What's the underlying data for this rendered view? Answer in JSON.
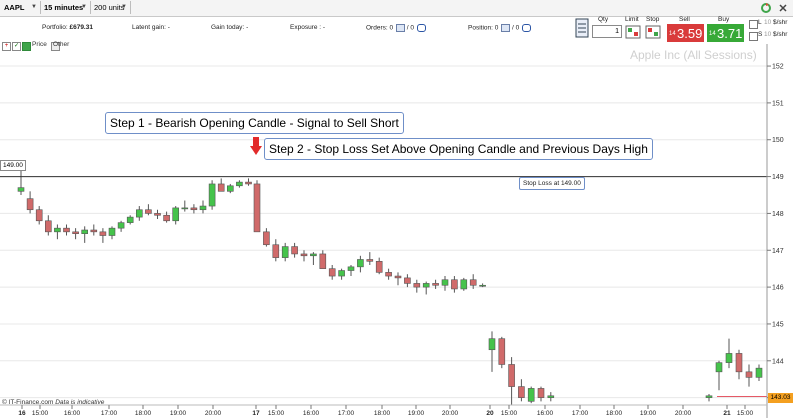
{
  "toolbar": {
    "symbol": "AAPL",
    "interval": "15 minutes",
    "units": "200 units"
  },
  "account": {
    "portfolio_label": "Portfolio:",
    "portfolio_value": "£679.31",
    "latent_gain_label": "Latent gain:",
    "latent_gain_value": "-",
    "gain_today_label": "Gain today:",
    "gain_today_value": "-",
    "exposure_label": "Exposure :",
    "exposure_value": "-",
    "orders_label": "Orders:",
    "orders_value": "0",
    "orders_value2": "0",
    "position_label": "Position:",
    "position_value": "0",
    "position_value2": "0"
  },
  "legend": {
    "price_label": "Price",
    "other_label": "Other"
  },
  "trade_panel": {
    "qty_label": "Qty",
    "qty_value": "1",
    "limit_label": "Limit",
    "stop_label": "Stop",
    "sell_label": "Sell",
    "sell_prefix": "14",
    "sell_price": "3.59",
    "buy_label": "Buy",
    "buy_prefix": "14",
    "buy_price": "3.71",
    "l_label": "L",
    "s_label": "S",
    "l_value": "10",
    "s_value": "10",
    "unit_label_1": "$/shr",
    "unit_label_2": "$/shr"
  },
  "watermark": "Apple Inc (All Sessions)",
  "annotations": {
    "step1": "Step 1 - Bearish Opening Candle - Signal to Sell Short",
    "step2": "Step 2 - Stop Loss Set Above Opening Candle and Previous Days High",
    "stop_loss": "Stop Loss at 149.00",
    "price_149_label": "149.00",
    "price_last_label": "143.03"
  },
  "footer": {
    "brand": "© IT-Finance.com",
    "note": "Data is indicative"
  },
  "colors": {
    "bull": "#45c34b",
    "bear": "#d06a6a",
    "stop_line": "#333333",
    "arrow": "#e22b2b",
    "last_price_bg": "#f4a020",
    "grid": "#e8e8e8"
  },
  "chart_data": {
    "type": "candlestick",
    "ylim": [
      142.8,
      152.3
    ],
    "y_ticks": [
      143,
      144,
      145,
      146,
      147,
      148,
      149,
      150,
      151,
      152
    ],
    "x_ticks": [
      "16",
      "15:00",
      "16:00",
      "17:00",
      "18:00",
      "19:00",
      "20:00",
      "17",
      "15:00",
      "16:00",
      "17:00",
      "18:00",
      "19:00",
      "20:00",
      "20",
      "15:00",
      "16:00",
      "17:00",
      "18:00",
      "19:00",
      "20:00",
      "21",
      "15:00"
    ],
    "bold_x_ticks": [
      "16",
      "17",
      "20",
      "21"
    ],
    "stop_loss_level": 149.0,
    "last_price": 143.03,
    "candles": [
      {
        "o": 148.6,
        "h": 149.3,
        "l": 148.5,
        "c": 148.7
      },
      {
        "o": 148.4,
        "h": 148.6,
        "l": 148.0,
        "c": 148.1
      },
      {
        "o": 148.1,
        "h": 148.2,
        "l": 147.7,
        "c": 147.8
      },
      {
        "o": 147.8,
        "h": 147.95,
        "l": 147.4,
        "c": 147.5
      },
      {
        "o": 147.5,
        "h": 147.7,
        "l": 147.3,
        "c": 147.6
      },
      {
        "o": 147.6,
        "h": 147.7,
        "l": 147.4,
        "c": 147.5
      },
      {
        "o": 147.5,
        "h": 147.6,
        "l": 147.3,
        "c": 147.45
      },
      {
        "o": 147.45,
        "h": 147.65,
        "l": 147.2,
        "c": 147.55
      },
      {
        "o": 147.55,
        "h": 147.7,
        "l": 147.4,
        "c": 147.5
      },
      {
        "o": 147.5,
        "h": 147.6,
        "l": 147.2,
        "c": 147.4
      },
      {
        "o": 147.4,
        "h": 147.65,
        "l": 147.3,
        "c": 147.6
      },
      {
        "o": 147.6,
        "h": 147.8,
        "l": 147.5,
        "c": 147.75
      },
      {
        "o": 147.75,
        "h": 147.95,
        "l": 147.7,
        "c": 147.9
      },
      {
        "o": 147.9,
        "h": 148.2,
        "l": 147.8,
        "c": 148.1
      },
      {
        "o": 148.1,
        "h": 148.25,
        "l": 147.95,
        "c": 148.0
      },
      {
        "o": 148.0,
        "h": 148.1,
        "l": 147.85,
        "c": 147.95
      },
      {
        "o": 147.95,
        "h": 148.05,
        "l": 147.75,
        "c": 147.8
      },
      {
        "o": 147.8,
        "h": 148.2,
        "l": 147.7,
        "c": 148.15
      },
      {
        "o": 148.15,
        "h": 148.35,
        "l": 148.05,
        "c": 148.15
      },
      {
        "o": 148.15,
        "h": 148.25,
        "l": 148.0,
        "c": 148.1
      },
      {
        "o": 148.1,
        "h": 148.35,
        "l": 148.0,
        "c": 148.2
      },
      {
        "o": 148.2,
        "h": 148.9,
        "l": 148.1,
        "c": 148.8
      },
      {
        "o": 148.8,
        "h": 148.95,
        "l": 148.6,
        "c": 148.6
      },
      {
        "o": 148.6,
        "h": 148.8,
        "l": 148.55,
        "c": 148.75
      },
      {
        "o": 148.75,
        "h": 148.9,
        "l": 148.7,
        "c": 148.85
      },
      {
        "o": 148.85,
        "h": 148.95,
        "l": 148.75,
        "c": 148.8
      },
      {
        "o": 148.8,
        "h": 148.9,
        "l": 147.5,
        "c": 147.5
      },
      {
        "o": 147.5,
        "h": 147.6,
        "l": 147.1,
        "c": 147.15
      },
      {
        "o": 147.15,
        "h": 147.3,
        "l": 146.7,
        "c": 146.8
      },
      {
        "o": 146.8,
        "h": 147.2,
        "l": 146.7,
        "c": 147.1
      },
      {
        "o": 147.1,
        "h": 147.2,
        "l": 146.8,
        "c": 146.9
      },
      {
        "o": 146.9,
        "h": 147.0,
        "l": 146.7,
        "c": 146.85
      },
      {
        "o": 146.85,
        "h": 146.95,
        "l": 146.6,
        "c": 146.9
      },
      {
        "o": 146.9,
        "h": 147.0,
        "l": 146.5,
        "c": 146.5
      },
      {
        "o": 146.5,
        "h": 146.6,
        "l": 146.2,
        "c": 146.3
      },
      {
        "o": 146.3,
        "h": 146.5,
        "l": 146.2,
        "c": 146.45
      },
      {
        "o": 146.45,
        "h": 146.6,
        "l": 146.3,
        "c": 146.55
      },
      {
        "o": 146.55,
        "h": 146.85,
        "l": 146.4,
        "c": 146.75
      },
      {
        "o": 146.75,
        "h": 146.95,
        "l": 146.6,
        "c": 146.7
      },
      {
        "o": 146.7,
        "h": 146.8,
        "l": 146.35,
        "c": 146.4
      },
      {
        "o": 146.4,
        "h": 146.5,
        "l": 146.2,
        "c": 146.3
      },
      {
        "o": 146.3,
        "h": 146.4,
        "l": 146.05,
        "c": 146.25
      },
      {
        "o": 146.25,
        "h": 146.35,
        "l": 146.0,
        "c": 146.1
      },
      {
        "o": 146.1,
        "h": 146.2,
        "l": 145.85,
        "c": 146.0
      },
      {
        "o": 146.0,
        "h": 146.15,
        "l": 145.8,
        "c": 146.1
      },
      {
        "o": 146.1,
        "h": 146.2,
        "l": 145.95,
        "c": 146.05
      },
      {
        "o": 146.05,
        "h": 146.3,
        "l": 145.9,
        "c": 146.2
      },
      {
        "o": 146.2,
        "h": 146.3,
        "l": 145.85,
        "c": 145.95
      },
      {
        "o": 145.95,
        "h": 146.25,
        "l": 145.9,
        "c": 146.2
      },
      {
        "o": 146.2,
        "h": 146.35,
        "l": 145.95,
        "c": 146.05
      },
      {
        "o": 146.05,
        "h": 146.1,
        "l": 146.0,
        "c": 146.05
      },
      {
        "o": 144.3,
        "h": 144.8,
        "l": 143.7,
        "c": 144.6
      },
      {
        "o": 144.6,
        "h": 144.65,
        "l": 143.8,
        "c": 143.9
      },
      {
        "o": 143.9,
        "h": 144.1,
        "l": 142.8,
        "c": 143.3
      },
      {
        "o": 143.3,
        "h": 143.5,
        "l": 142.9,
        "c": 143.0
      },
      {
        "o": 142.9,
        "h": 143.3,
        "l": 142.85,
        "c": 143.25
      },
      {
        "o": 143.25,
        "h": 143.3,
        "l": 142.9,
        "c": 143.0
      },
      {
        "o": 143.0,
        "h": 143.15,
        "l": 142.9,
        "c": 143.05
      },
      {
        "o": 143.0,
        "h": 143.1,
        "l": 142.9,
        "c": 143.05
      },
      {
        "o": 143.7,
        "h": 144.0,
        "l": 143.2,
        "c": 143.95
      },
      {
        "o": 143.95,
        "h": 144.6,
        "l": 143.8,
        "c": 144.2
      },
      {
        "o": 144.2,
        "h": 144.3,
        "l": 143.5,
        "c": 143.7
      },
      {
        "o": 143.7,
        "h": 143.9,
        "l": 143.3,
        "c": 143.55
      },
      {
        "o": 143.55,
        "h": 143.9,
        "l": 143.45,
        "c": 143.8
      }
    ]
  }
}
